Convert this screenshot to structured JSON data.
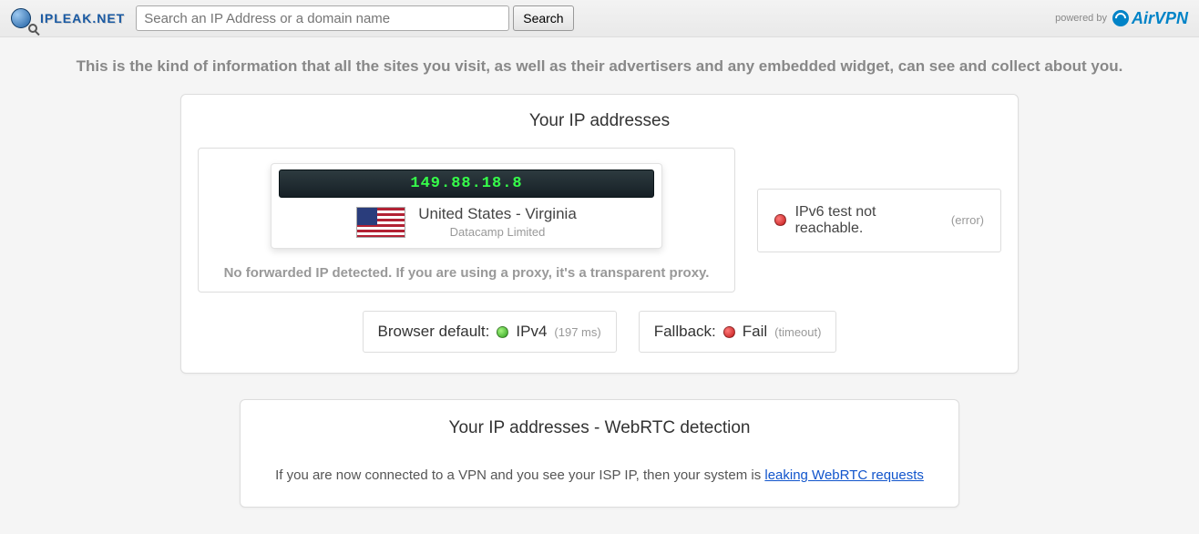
{
  "header": {
    "logo_text": "IPLEAK.NET",
    "search_placeholder": "Search an IP Address or a domain name",
    "search_button": "Search",
    "powered_by": "powered by",
    "sponsor": "AirVPN"
  },
  "intro": "This is the kind of information that all the sites you visit, as well as their advertisers and any embedded widget, can see and collect about you.",
  "ip_panel": {
    "title": "Your IP addresses",
    "ip": "149.88.18.8",
    "location": "United States - Virginia",
    "isp": "Datacamp Limited",
    "proxy_note": "No forwarded IP detected. If you are using a proxy, it's a transparent proxy.",
    "ipv6_status": "IPv6 test not reachable.",
    "ipv6_note": "(error)",
    "browser_default_label": "Browser default:",
    "browser_default_value": "IPv4",
    "browser_default_timing": "(197 ms)",
    "fallback_label": "Fallback:",
    "fallback_value": "Fail",
    "fallback_note": "(timeout)"
  },
  "webrtc_panel": {
    "title": "Your IP addresses - WebRTC detection",
    "text_before": "If you are now connected to a VPN and you see your ISP IP, then your system is ",
    "link_text": "leaking WebRTC requests"
  }
}
